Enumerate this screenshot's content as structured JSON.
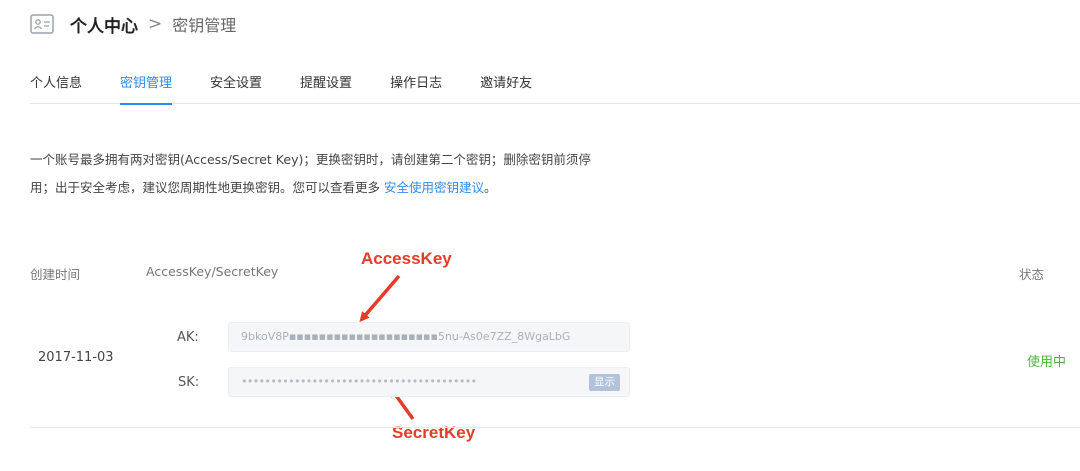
{
  "header": {
    "title": "个人中心",
    "separator": ">",
    "subtitle": "密钥管理",
    "icon": "profile-card-icon"
  },
  "tabs": [
    {
      "label": "个人信息",
      "active": false
    },
    {
      "label": "密钥管理",
      "active": true
    },
    {
      "label": "安全设置",
      "active": false
    },
    {
      "label": "提醒设置",
      "active": false
    },
    {
      "label": "操作日志",
      "active": false
    },
    {
      "label": "邀请好友",
      "active": false
    }
  ],
  "description": {
    "line1": "一个账号最多拥有两对密钥(Access/Secret Key)；更换密钥时，请创建第二个密钥；删除密钥前须停",
    "line2_prefix": "用；出于安全考虑，建议您周期性地更换密钥。您可以查看更多 ",
    "link": "安全使用密钥建议",
    "line2_suffix": "。"
  },
  "table": {
    "columns": {
      "created": "创建时间",
      "keys": "AccessKey/SecretKey",
      "status": "状态"
    },
    "row": {
      "created": "2017-11-03",
      "ak_label": "AK:",
      "ak_value": "9bkoV8P▪▪▪▪▪▪▪▪▪▪▪▪▪▪▪▪▪▪▪▪5nu-As0e7ZZ_8WgaLbG",
      "sk_label": "SK:",
      "sk_value": "••••••••••••••••••••••••••••••••••••••••",
      "show_label": "显示",
      "status": "使用中"
    }
  },
  "annotations": {
    "access": "AccessKey",
    "secret": "SecretKey"
  },
  "colors": {
    "accent": "#2d8cf0",
    "status": "#52b043",
    "annotation": "#e23d28"
  }
}
